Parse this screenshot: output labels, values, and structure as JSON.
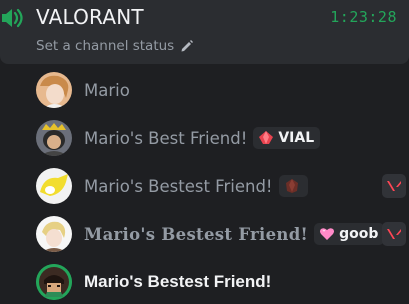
{
  "channel": {
    "name": "VALORANT",
    "timer": "1:23:28",
    "status_placeholder": "Set a channel status"
  },
  "members": [
    {
      "name": "Mario",
      "tag": null,
      "activity": false
    },
    {
      "name": "Mario's Best Friend!",
      "tag": "VIAL",
      "activity": false
    },
    {
      "name": "Mario's Bestest Friend!",
      "tag": "",
      "activity": true
    },
    {
      "name": "Mario's Bestest Friend!",
      "tag": "goob",
      "activity": true
    },
    {
      "name": "Mario's Bestest Friend!",
      "tag": null,
      "activity": false,
      "active": true
    }
  ],
  "colors": {
    "background": "#1e1f22",
    "panel": "#2b2d31",
    "timer": "#23a55a",
    "speaker": "#23a55a",
    "valorant": "#ff4655"
  }
}
